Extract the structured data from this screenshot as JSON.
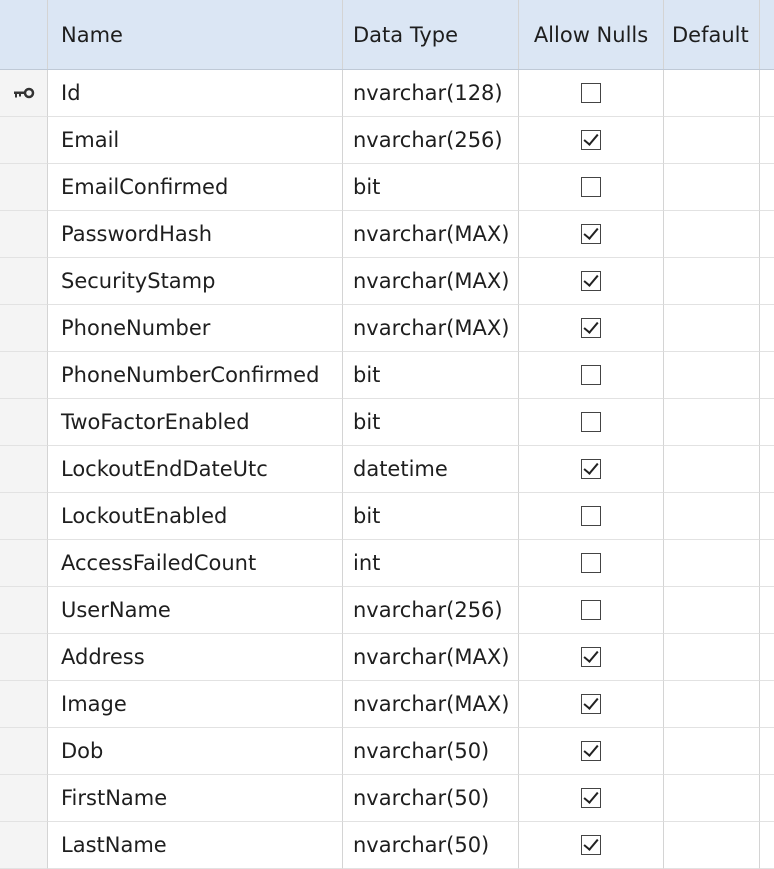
{
  "columns": {
    "name": "Name",
    "data_type": "Data Type",
    "allow_nulls": "Allow Nulls",
    "default": "Default"
  },
  "primary_key_icon": "key-icon",
  "rows": [
    {
      "name": "Id",
      "type": "nvarchar(128)",
      "nulls": false,
      "pk": true
    },
    {
      "name": "Email",
      "type": "nvarchar(256)",
      "nulls": true
    },
    {
      "name": "EmailConfirmed",
      "type": "bit",
      "nulls": false
    },
    {
      "name": "PasswordHash",
      "type": "nvarchar(MAX)",
      "nulls": true
    },
    {
      "name": "SecurityStamp",
      "type": "nvarchar(MAX)",
      "nulls": true
    },
    {
      "name": "PhoneNumber",
      "type": "nvarchar(MAX)",
      "nulls": true
    },
    {
      "name": "PhoneNumberConfirmed",
      "type": "bit",
      "nulls": false
    },
    {
      "name": "TwoFactorEnabled",
      "type": "bit",
      "nulls": false
    },
    {
      "name": "LockoutEndDateUtc",
      "type": "datetime",
      "nulls": true
    },
    {
      "name": "LockoutEnabled",
      "type": "bit",
      "nulls": false
    },
    {
      "name": "AccessFailedCount",
      "type": "int",
      "nulls": false
    },
    {
      "name": "UserName",
      "type": "nvarchar(256)",
      "nulls": false
    },
    {
      "name": "Address",
      "type": "nvarchar(MAX)",
      "nulls": true
    },
    {
      "name": "Image",
      "type": "nvarchar(MAX)",
      "nulls": true
    },
    {
      "name": "Dob",
      "type": "nvarchar(50)",
      "nulls": true
    },
    {
      "name": "FirstName",
      "type": "nvarchar(50)",
      "nulls": true
    },
    {
      "name": "LastName",
      "type": "nvarchar(50)",
      "nulls": true
    }
  ]
}
